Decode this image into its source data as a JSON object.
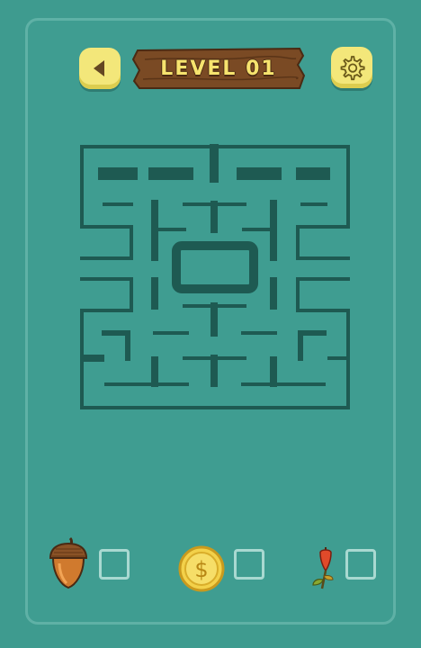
{
  "header": {
    "level_title": "LEVEL 01",
    "back_icon": "back-arrow-icon",
    "settings_icon": "gear-icon"
  },
  "colors": {
    "background": "#3e9b8f",
    "maze_walls": "#1e5a52",
    "button_yellow": "#f3e77a",
    "plank_brown": "#7a4a24"
  },
  "collectibles": [
    {
      "name": "acorn",
      "icon": "acorn-icon"
    },
    {
      "name": "coin",
      "icon": "coin-icon",
      "symbol": "$"
    },
    {
      "name": "rosehip",
      "icon": "rosehip-icon"
    }
  ]
}
